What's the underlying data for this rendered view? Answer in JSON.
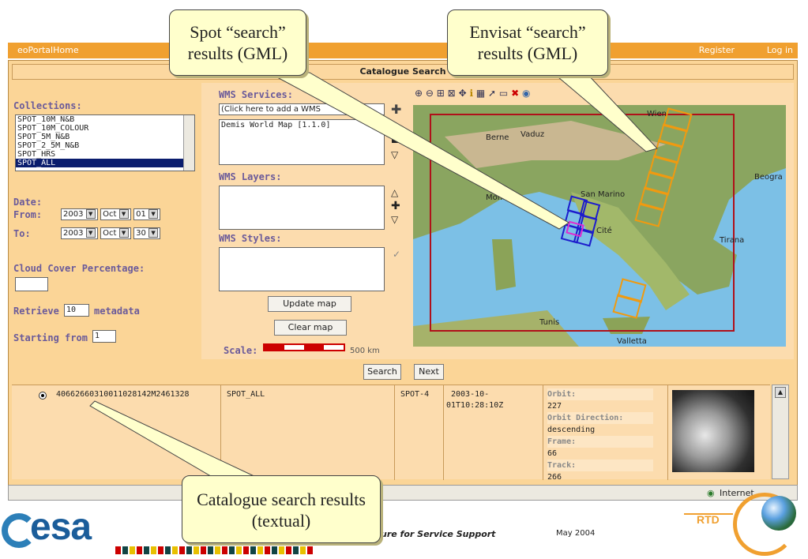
{
  "topbar": {
    "home": "eoPortalHome",
    "register": "Register",
    "login": "Log in"
  },
  "title": "Catalogue Search",
  "left": {
    "collections_label": "Collections:",
    "collections": [
      "SPOT_10M_N&B",
      "SPOT_10M_COLOUR",
      "SPOT_5M_N&B",
      "SPOT_2_5M_N&B",
      "SPOT_HRS",
      "SPOT_ALL"
    ],
    "date_label": "Date:",
    "from_label": "From:",
    "to_label": "To:",
    "from_year": "2003",
    "from_month": "Oct",
    "from_day": "01",
    "to_year": "2003",
    "to_month": "Oct",
    "to_day": "30",
    "cloud_label": "Cloud Cover Percentage:",
    "retrieve_label": "Retrieve",
    "retrieve_value": "10",
    "metadata_label": "metadata",
    "starting_label": "Starting from",
    "starting_value": "1"
  },
  "wms": {
    "services_label": "WMS Services:",
    "services_select": "(Click here to add a WMS",
    "services_list": [
      "Demis World Map [1.1.0]"
    ],
    "layers_label": "WMS Layers:",
    "styles_label": "WMS Styles:",
    "update_button": "Update map",
    "clear_button": "Clear map",
    "scale_label": "Scale:",
    "scale_value": "500 km"
  },
  "map": {
    "places": [
      "Wien",
      "Berne",
      "Vaduz",
      "Beogra",
      "San Marino",
      "Monac",
      "Tirana",
      "Tunis",
      "Valletta",
      "Cité"
    ]
  },
  "search_button": "Search",
  "next_button": "Next",
  "result": {
    "id": "40662660310011028142M2461328",
    "collection": "SPOT_ALL",
    "satellite": "SPOT-4",
    "date_line1": "2003-10-",
    "date_line2": "01T10:28:10Z",
    "orbit_label": "Orbit:",
    "orbit_value": "227",
    "orbit_dir_label": "Orbit Direction:",
    "orbit_dir_value": "descending",
    "frame_label": "Frame:",
    "frame_value": "66",
    "track_label": "Track:",
    "track_value": "266"
  },
  "status": {
    "zone": "Internet"
  },
  "callouts": {
    "spot": "Spot “search” results (GML)",
    "envisat": "Envisat “search” results (GML)",
    "catalogue": "Catalogue search results (textual)"
  },
  "footer": {
    "esa": "esa",
    "tagline": "ure for Service Support",
    "date": "May 2004",
    "rtd": "RTD"
  },
  "colors": {
    "orange_bar": "#f0a030",
    "panel": "#fbd597",
    "selection": "#0a1d6e",
    "spot_box": "#1d1dcc",
    "envisat_box": "#f09a10",
    "search_area": "#b0101a"
  }
}
